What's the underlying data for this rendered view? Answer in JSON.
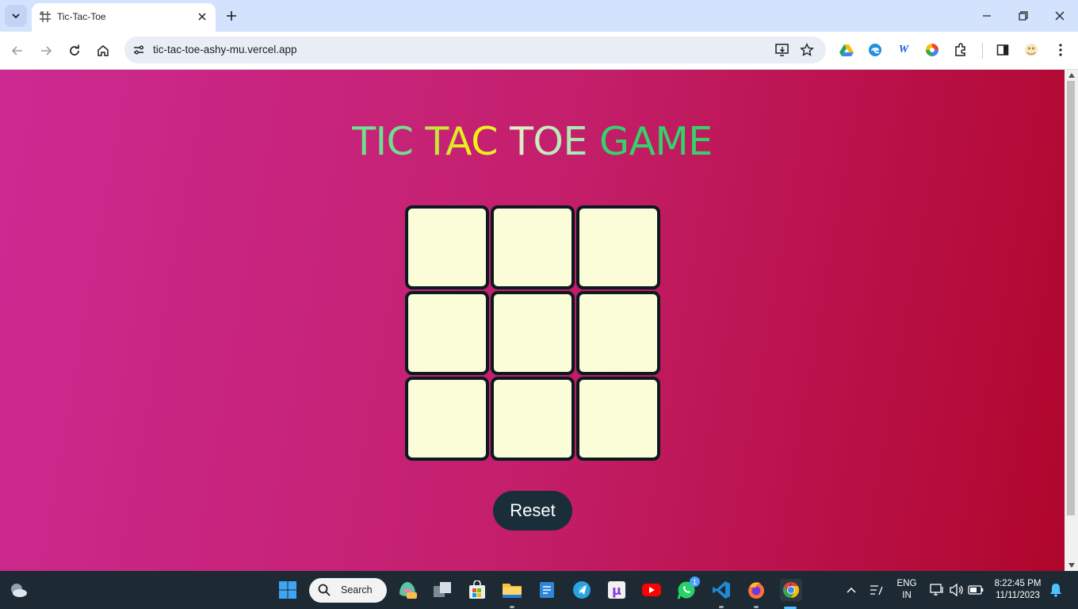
{
  "browser": {
    "tab_title": "Tic-Tac-Toe",
    "url": "tic-tac-toe-ashy-mu.vercel.app"
  },
  "game": {
    "title_words": [
      "TIC",
      "TAC",
      "TOE",
      "GAME"
    ],
    "cells": [
      "",
      "",
      "",
      "",
      "",
      "",
      "",
      "",
      ""
    ],
    "reset_label": "Reset"
  },
  "colors": {
    "page_gradient_start": "#cc2a92",
    "page_gradient_end": "#b0062c",
    "cell_fill": "#fafdd8",
    "cell_border": "#0c1a1f",
    "reset_bg": "#1a2e3a"
  },
  "taskbar": {
    "search_label": "Search",
    "whatsapp_badge": "1",
    "language_line1": "ENG",
    "language_line2": "IN",
    "time": "8:22:45 PM",
    "date": "11/11/2023"
  }
}
